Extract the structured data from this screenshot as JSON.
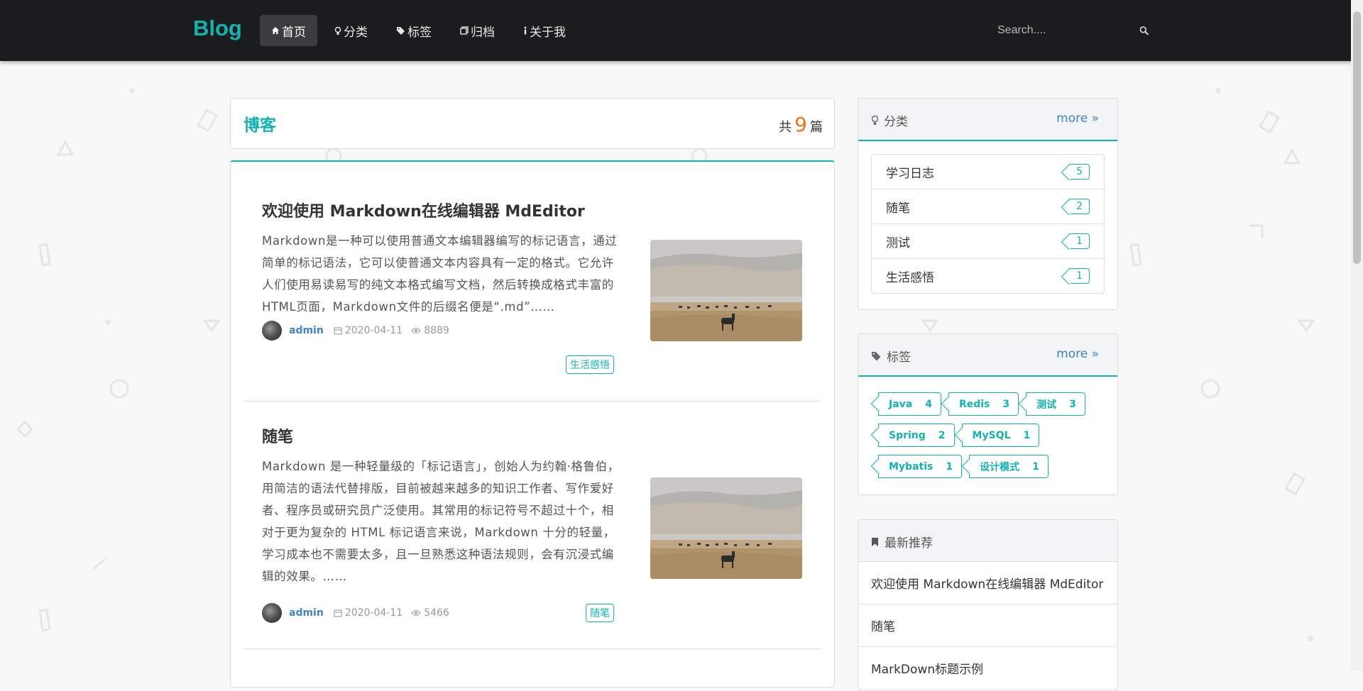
{
  "brand": "Blog",
  "nav": [
    {
      "label": "首页",
      "icon": "home-icon",
      "active": true
    },
    {
      "label": "分类",
      "icon": "lightbulb-icon",
      "active": false
    },
    {
      "label": "标签",
      "icon": "tags-icon",
      "active": false
    },
    {
      "label": "归档",
      "icon": "clone-icon",
      "active": false
    },
    {
      "label": "关于我",
      "icon": "info-icon",
      "active": false
    }
  ],
  "search": {
    "placeholder": "Search...."
  },
  "blog": {
    "title": "博客",
    "count_prefix": "共",
    "count": "9",
    "count_suffix": "篇"
  },
  "posts": [
    {
      "title": "欢迎使用 Markdown在线编辑器 MdEditor",
      "summary": "Markdown是一种可以使用普通文本编辑器编写的标记语言，通过简单的标记语法，它可以使普通文本内容具有一定的格式。它允许人们使用易读易写的纯文本格式编写文档，然后转换成格式丰富的HTML页面，Markdown文件的后缀名便是“.md”……",
      "author": "admin",
      "date": "2020-04-11",
      "views": "8889",
      "tag": "生活感悟"
    },
    {
      "title": "随笔",
      "summary": "Markdown 是一种轻量级的「标记语言」，创始人为约翰·格鲁伯，用简洁的语法代替排版，目前被越来越多的知识工作者、写作爱好者、程序员或研究员广泛使用。其常用的标记符号不超过十个，相对于更为复杂的 HTML 标记语言来说，Markdown 十分的轻量，学习成本也不需要太多，且一旦熟悉这种语法规则，会有沉浸式编辑的效果。……",
      "author": "admin",
      "date": "2020-04-11",
      "views": "5466",
      "tag": "随笔"
    }
  ],
  "categories": {
    "title": "分类",
    "more": "more",
    "items": [
      {
        "name": "学习日志",
        "count": "5"
      },
      {
        "name": "随笔",
        "count": "2"
      },
      {
        "name": "测试",
        "count": "1"
      },
      {
        "name": "生活感悟",
        "count": "1"
      }
    ]
  },
  "tags": {
    "title": "标签",
    "more": "more",
    "items": [
      {
        "name": "Java",
        "count": "4"
      },
      {
        "name": "Redis",
        "count": "3"
      },
      {
        "name": "测试",
        "count": "3"
      },
      {
        "name": "Spring",
        "count": "2"
      },
      {
        "name": "MySQL",
        "count": "1"
      },
      {
        "name": "Mybatis",
        "count": "1"
      },
      {
        "name": "设计模式",
        "count": "1"
      }
    ]
  },
  "recommend": {
    "title": "最新推荐",
    "items": [
      "欢迎使用 Markdown在线编辑器 MdEditor",
      "随笔",
      "MarkDown标题示例"
    ]
  },
  "colors": {
    "accent": "#14b2b2",
    "nav_bg": "#1b1c1d",
    "link": "#4183c4",
    "count": "#f2711c"
  }
}
